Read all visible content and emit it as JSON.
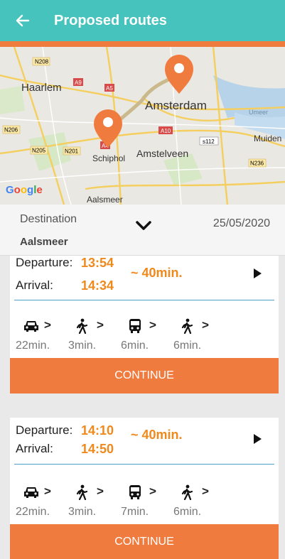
{
  "header": {
    "title": "Proposed routes",
    "back_icon": "arrow-left-icon"
  },
  "map": {
    "labels": [
      "Haarlem",
      "Amsterdam",
      "Schiphol",
      "Amstelveen",
      "Aalsmeer",
      "Muiden",
      "Umeer",
      "Google"
    ],
    "road_badges": [
      "N208",
      "A9",
      "A5",
      "A10",
      "s112",
      "N206",
      "N205",
      "N201",
      "N236",
      "A4"
    ],
    "pin_color": "#f07b3f",
    "route_color": "#c9b98d"
  },
  "destination": {
    "label": "Destination",
    "value": "Aalsmeer",
    "date": "25/05/2020"
  },
  "routes": [
    {
      "departure_label": "Departure:",
      "departure_time": "13:54",
      "arrival_label": "Arrival:",
      "arrival_time": "14:34",
      "duration": "~ 40min.",
      "steps": [
        {
          "icon": "car-icon",
          "minutes": "22min."
        },
        {
          "icon": "walk-icon",
          "minutes": "3min."
        },
        {
          "icon": "bus-icon",
          "minutes": "6min."
        },
        {
          "icon": "walk-icon",
          "minutes": "6min."
        }
      ],
      "continue_label": "CONTINUE"
    },
    {
      "departure_label": "Departure:",
      "departure_time": "14:10",
      "arrival_label": "Arrival:",
      "arrival_time": "14:50",
      "duration": "~ 40min.",
      "steps": [
        {
          "icon": "car-icon",
          "minutes": "22min."
        },
        {
          "icon": "walk-icon",
          "minutes": "3min."
        },
        {
          "icon": "bus-icon",
          "minutes": "7min."
        },
        {
          "icon": "walk-icon",
          "minutes": "6min."
        }
      ],
      "continue_label": "CONTINUE"
    }
  ],
  "step_arrow": ">",
  "colors": {
    "header": "#45c3bc",
    "accent": "#f07b3f",
    "time": "#f0891c",
    "separator": "#4aa3cd"
  }
}
